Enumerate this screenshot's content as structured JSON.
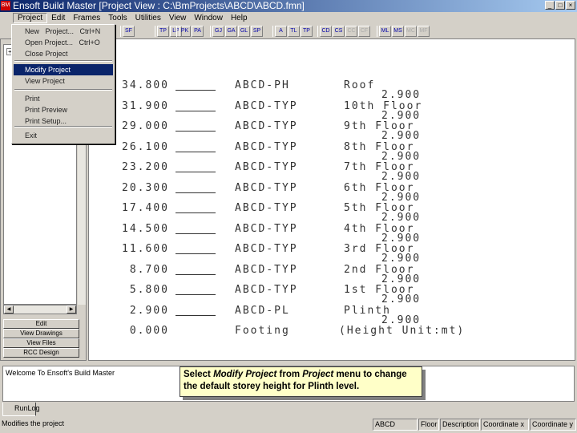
{
  "title": "Ensoft Build Master    [Project View : C:\\BmProjects\\ABCD\\ABCD.fmn]",
  "menus": [
    "Project",
    "Edit",
    "Frames",
    "Tools",
    "Utilities",
    "View",
    "Window",
    "Help"
  ],
  "toolbar_groups": [
    [
      "SF"
    ],
    [
      "TP",
      "LP"
    ],
    [
      "PK",
      "PA"
    ],
    [
      "GJ",
      "GA",
      "GL",
      "SP"
    ],
    [
      "A",
      "TL",
      "TP"
    ],
    [
      "CD",
      "CS",
      "CC",
      "CF"
    ],
    [
      "ML",
      "MS",
      "MC",
      "MF"
    ]
  ],
  "project_menu": {
    "items": [
      "New   Project...   Ctrl+N",
      "Open Project...   Ctrl+O",
      "Close Project",
      "Modify Project",
      "View Project",
      "Print",
      "Print Preview",
      "Print Setup...",
      "Exit"
    ],
    "selected": "Modify Project"
  },
  "nav_buttons": [
    "Edit",
    "View Drawings",
    "View Files",
    "RCC Design"
  ],
  "levels": [
    {
      "elev": "34.800",
      "name": "ABCD-PH",
      "floor": "Roof",
      "height": "2.900"
    },
    {
      "elev": "31.900",
      "name": "ABCD-TYP",
      "floor": "10th Floor",
      "height": "2.900"
    },
    {
      "elev": "29.000",
      "name": "ABCD-TYP",
      "floor": "9th Floor",
      "height": "2.900"
    },
    {
      "elev": "26.100",
      "name": "ABCD-TYP",
      "floor": "8th Floor",
      "height": "2.900"
    },
    {
      "elev": "23.200",
      "name": "ABCD-TYP",
      "floor": "7th Floor",
      "height": "2.900"
    },
    {
      "elev": "20.300",
      "name": "ABCD-TYP",
      "floor": "6th Floor",
      "height": "2.900"
    },
    {
      "elev": "17.400",
      "name": "ABCD-TYP",
      "floor": "5th Floor",
      "height": "2.900"
    },
    {
      "elev": "14.500",
      "name": "ABCD-TYP",
      "floor": "4th Floor",
      "height": "2.900"
    },
    {
      "elev": "11.600",
      "name": "ABCD-TYP",
      "floor": "3rd Floor",
      "height": "2.900"
    },
    {
      "elev": "8.700",
      "name": "ABCD-TYP",
      "floor": "2nd Floor",
      "height": "2.900"
    },
    {
      "elev": "5.800",
      "name": "ABCD-TYP",
      "floor": "1st Floor",
      "height": "2.900"
    },
    {
      "elev": "2.900",
      "name": "ABCD-PL",
      "floor": "Plinth",
      "height": "2.900"
    },
    {
      "elev": "0.000",
      "name": "Footing",
      "floor": "(Height Unit:mt)",
      "height": ""
    }
  ],
  "output": {
    "text": "Welcome To Ensoft's Build Master",
    "tab": "RunLog"
  },
  "tip": {
    "pre": "Select ",
    "em1": "Modify Project",
    "mid": " from ",
    "em2": "Project",
    "post": " menu to change the default storey height for Plinth level."
  },
  "status": {
    "message": "Modifies the project",
    "panes": [
      "ABCD",
      "Floor",
      "Description",
      "Coordinate x",
      "Coordinate y"
    ]
  }
}
